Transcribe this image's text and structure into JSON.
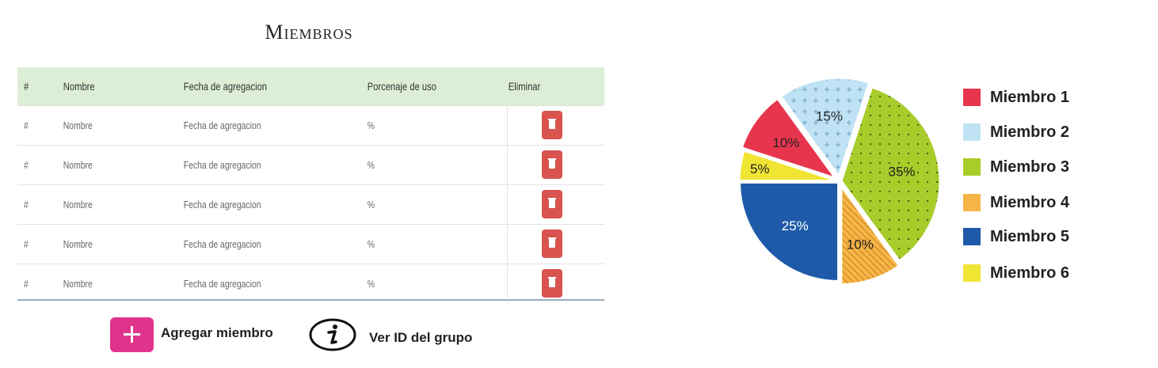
{
  "page_title": "Miembros",
  "table": {
    "headers": [
      "#",
      "Nombre",
      "Fecha de agregacion",
      "Porcenaje de uso",
      "Eliminar"
    ],
    "rows": [
      {
        "num": "#",
        "name": "Nombre",
        "date": "Fecha de agregacion",
        "pct": "%"
      },
      {
        "num": "#",
        "name": "Nombre",
        "date": "Fecha de agregacion",
        "pct": "%"
      },
      {
        "num": "#",
        "name": "Nombre",
        "date": "Fecha de agregacion",
        "pct": "%"
      },
      {
        "num": "#",
        "name": "Nombre",
        "date": "Fecha de agregacion",
        "pct": "%"
      },
      {
        "num": "#",
        "name": "Nombre",
        "date": "Fecha de agregacion",
        "pct": "%"
      }
    ],
    "delete_icon": "trash-icon",
    "delete_color": "#d9534f",
    "header_bg": "#dcefd6"
  },
  "actions": {
    "add_member_label": "Agregar miembro",
    "add_member_icon": "plus-icon",
    "add_member_color": "#e0338b",
    "view_group_id_label": "Ver ID del grupo",
    "view_group_id_icon": "info-icon"
  },
  "chart_data": {
    "type": "pie",
    "labels": [
      "Miembro 1",
      "Miembro 2",
      "Miembro 3",
      "Miembro 4",
      "Miembro 5",
      "Miembro 6"
    ],
    "values": [
      10,
      15,
      35,
      10,
      25,
      5
    ],
    "value_labels": [
      "10%",
      "15%",
      "35%",
      "10%",
      "25%",
      "5%"
    ],
    "colors": [
      "#e8354e",
      "#bfe3f5",
      "#a8cc2a",
      "#f6b548",
      "#1e5aa8",
      "#f1e534"
    ],
    "legend_position": "right"
  }
}
